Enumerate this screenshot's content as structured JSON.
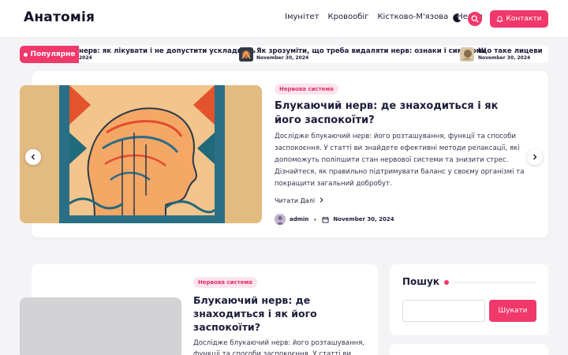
{
  "site": {
    "title": "Анатомія"
  },
  "nav": {
    "items": [
      "Імунітет",
      "Кровообіг",
      "Кістково-М'язова",
      "Нерви"
    ]
  },
  "header": {
    "contact_label": "Контакти"
  },
  "ticker": {
    "label": "Популярне",
    "items": [
      {
        "title": "нерв: як лікувати і не допустити ускладнень",
        "date": "2024"
      },
      {
        "title": "Як зрозуміти, що треба видаляти нерв: ознаки і симптоми",
        "date": "November 30, 2024"
      },
      {
        "title": "Що таке лицеви",
        "date": "November 30, 2024"
      }
    ]
  },
  "hero": {
    "category": "Нервова система",
    "title": "Блукаючий нерв: де знаходиться і як його заспокоїти?",
    "excerpt": "Дослідже блукаючий нерв: його розташування, функції та способи заспокоєння. У статті ви знайдете ефективні методи релаксації, які допоможуть поліпшити стан нервової системи та знизити стрес. Дізнайтеся, як правильно підтримувати баланс у своєму організмі та покращити загальний добробут.",
    "read_more": "Читати Далі",
    "author": "admin",
    "date": "November 30, 2024"
  },
  "post": {
    "category": "Нервова система",
    "title": "Блукаючий нерв: де знаходиться і як його заспокоїти?",
    "excerpt": "Дослідже блукаючий нерв: його розташування, функції та способи заспокоєння. У статті ви"
  },
  "sidebar": {
    "search_title": "Пошук",
    "search_placeholder": "",
    "search_button": "Шукати"
  },
  "colors": {
    "accent": "#f0386b",
    "dark": "#1f2340",
    "badge_bg": "#fde4ec"
  },
  "icons": [
    "moon-icon",
    "search-icon",
    "bell-icon",
    "pause-icon",
    "chevron-left-icon",
    "chevron-right-icon",
    "calendar-icon"
  ]
}
